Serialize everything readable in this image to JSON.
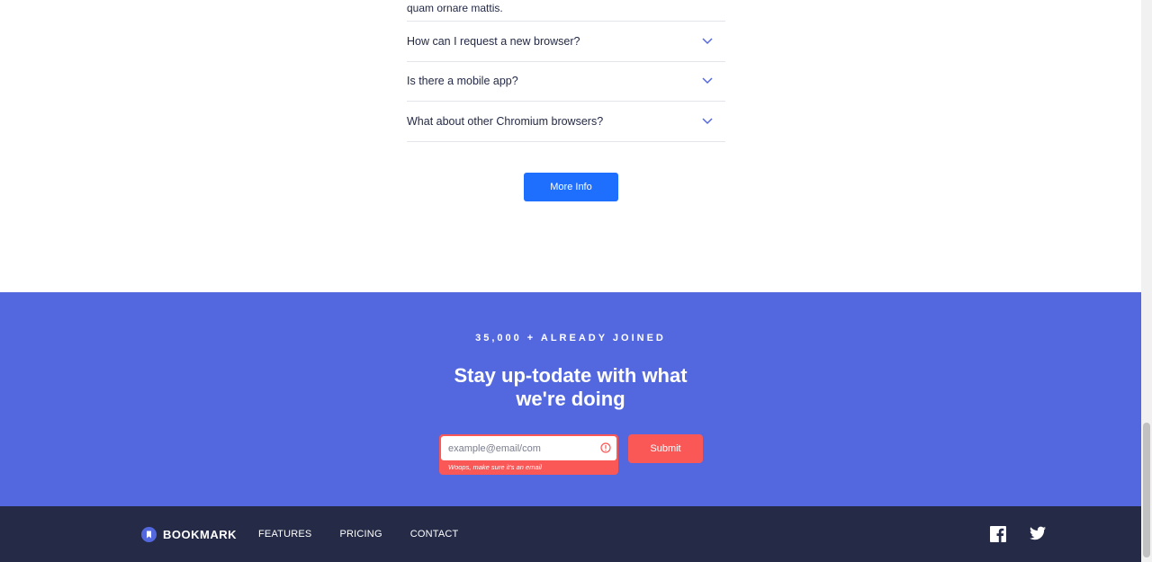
{
  "faq": {
    "partial_answer": "quam ornare mattis.",
    "items": [
      {
        "question": "How can I request a new browser?"
      },
      {
        "question": "Is there a mobile app?"
      },
      {
        "question": "What about other Chromium browsers?"
      }
    ],
    "more_info_label": "More Info"
  },
  "newsletter": {
    "joined": "35,000 + ALREADY JOINED",
    "title": "Stay up-todate with what we're doing",
    "email_placeholder": "example@email/com",
    "error_message": "Woops, make sure it's an email",
    "submit_label": "Submit"
  },
  "footer": {
    "brand": "BOOKMARK",
    "nav": [
      "FEATURES",
      "PRICING",
      "CONTACT"
    ],
    "social": [
      "facebook-icon",
      "twitter-icon"
    ]
  },
  "colors": {
    "primary_blue": "#5368DF",
    "soft_red": "#FA5757",
    "dark_navy": "#252B46",
    "button_blue": "#1F6FFF"
  }
}
